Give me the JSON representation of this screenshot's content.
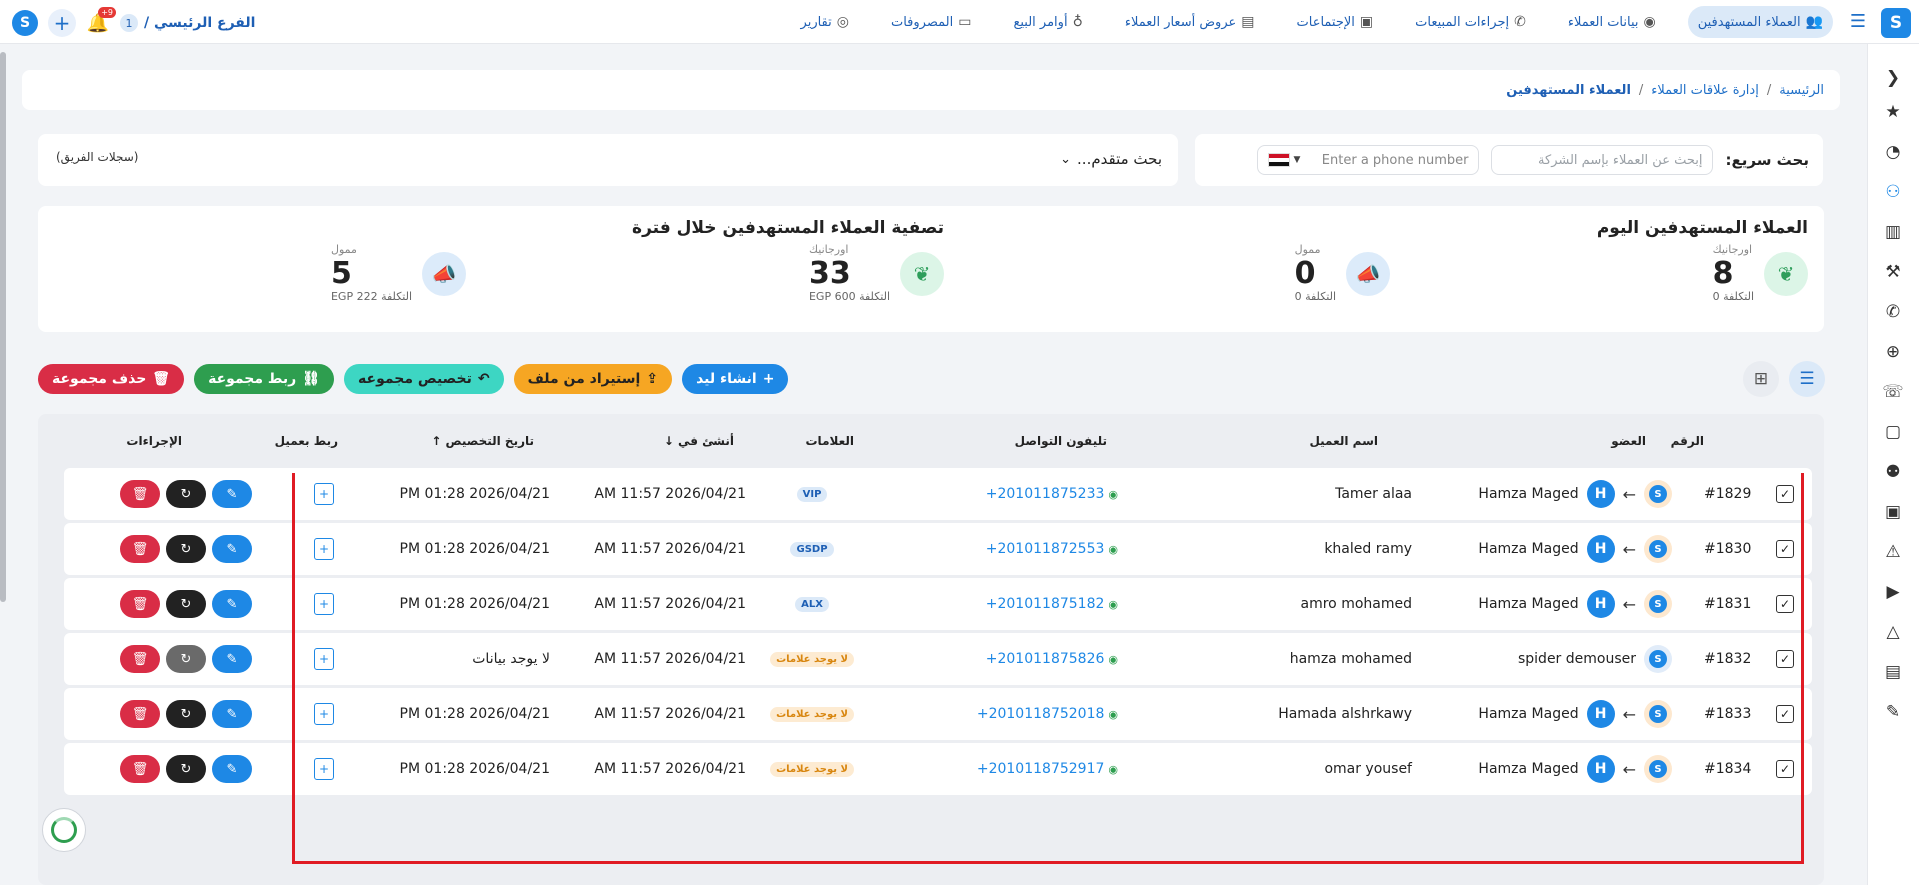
{
  "topbar": {
    "brand_logo": "S",
    "branch_number": "1",
    "branch_name": "الفرع الرئيسي /",
    "notification_count": "+9",
    "nav": [
      {
        "label": "العملاء المستهدفين",
        "icon": "target-users-icon",
        "active": true
      },
      {
        "label": "بيانات العملاء",
        "icon": "user-data-icon",
        "active": false
      },
      {
        "label": "إجراءات المبيعات",
        "icon": "phone-icon",
        "active": false
      },
      {
        "label": "الإجتماعات",
        "icon": "presentation-icon",
        "active": false
      },
      {
        "label": "عروض أسعار العملاء",
        "icon": "quote-icon",
        "active": false
      },
      {
        "label": "أوامر البيع",
        "icon": "money-bag-icon",
        "active": false
      },
      {
        "label": "المصروفات",
        "icon": "laptop-icon",
        "active": false
      },
      {
        "label": "تقارير",
        "icon": "report-icon",
        "active": false
      }
    ]
  },
  "breadcrumb": {
    "home": "الرئيسية",
    "section": "إدارة علاقات العملاء",
    "current": "العملاء المستهدفين",
    "sep": "/"
  },
  "search": {
    "label": "بحث سريع:",
    "company_placeholder": "إبحث عن العملاء بإسم الشركة",
    "phone_placeholder": "Enter a phone number",
    "advanced": "بحث متقدم...",
    "team_records": "(سجلات الفريق)"
  },
  "stats": {
    "today_title": "العملاء المستهدفين اليوم",
    "period_title": "تصفية العملاء المستهدفين خلال فترة",
    "items": [
      {
        "label": "اورجانيك",
        "value": "8",
        "cost": "التكلفة 0",
        "color": "green"
      },
      {
        "label": "ممول",
        "value": "0",
        "cost": "التكلفة 0",
        "color": "blue"
      },
      {
        "label": "اورجانيك",
        "value": "33",
        "cost": "التكلفة EGP 600",
        "color": "green"
      },
      {
        "label": "ممول",
        "value": "5",
        "cost": "التكلفة EGP 222",
        "color": "blue"
      }
    ]
  },
  "actions": {
    "create_lead": "انشاء ليد",
    "import_file": "إستيراد من ملف",
    "assign_group": "تخصيص مجموعه",
    "link_group": "ربط مجموعة",
    "delete_group": "حذف مجموعة"
  },
  "table": {
    "headers": {
      "number": "الرقم",
      "member": "العضو",
      "client_name": "اسم العميل",
      "phone": "تليفون التواصل",
      "tags": "العلامات",
      "created_at": "أنشئ في",
      "assigned_at": "تاريخ التخصيص",
      "link_client": "ربط بعميل",
      "actions": "الإجراءات"
    },
    "rows": [
      {
        "number": "#1829",
        "member": "Hamza Maged",
        "has_transfer": true,
        "client": "Tamer alaa",
        "phone": "+201011875233",
        "tag": "VIP",
        "tag_type": "vip",
        "created": "AM 11:57 2026/04/21",
        "assigned": "PM 01:28 2026/04/21",
        "refresh_dim": false
      },
      {
        "number": "#1830",
        "member": "Hamza Maged",
        "has_transfer": true,
        "client": "khaled ramy",
        "phone": "+201011872553",
        "tag": "GSDP",
        "tag_type": "vip",
        "created": "AM 11:57 2026/04/21",
        "assigned": "PM 01:28 2026/04/21",
        "refresh_dim": false
      },
      {
        "number": "#1831",
        "member": "Hamza Maged",
        "has_transfer": true,
        "client": "amro mohamed",
        "phone": "+201011875182",
        "tag": "ALX",
        "tag_type": "vip",
        "created": "AM 11:57 2026/04/21",
        "assigned": "PM 01:28 2026/04/21",
        "refresh_dim": false
      },
      {
        "number": "#1832",
        "member": "spider demouser",
        "has_transfer": false,
        "client": "hamza mohamed",
        "phone": "+201011875826",
        "tag": "لا يوجد علامات",
        "tag_type": "none",
        "created": "AM 11:57 2026/04/21",
        "assigned": "لا يوجد بيانات",
        "refresh_dim": true
      },
      {
        "number": "#1833",
        "member": "Hamza Maged",
        "has_transfer": true,
        "client": "Hamada alshrkawy",
        "phone": "+2010118752018",
        "tag": "لا يوجد علامات",
        "tag_type": "none",
        "created": "AM 11:57 2026/04/21",
        "assigned": "PM 01:28 2026/04/21",
        "refresh_dim": false
      },
      {
        "number": "#1834",
        "member": "Hamza Maged",
        "has_transfer": true,
        "client": "omar yousef",
        "phone": "+2010118752917",
        "tag": "لا يوجد علامات",
        "tag_type": "none",
        "created": "AM 11:57 2026/04/21",
        "assigned": "PM 01:28 2026/04/21",
        "refresh_dim": false
      }
    ]
  },
  "colors": {
    "accent": "#1e88e5",
    "danger": "#d92d46",
    "highlight_box": "#e01b24"
  }
}
